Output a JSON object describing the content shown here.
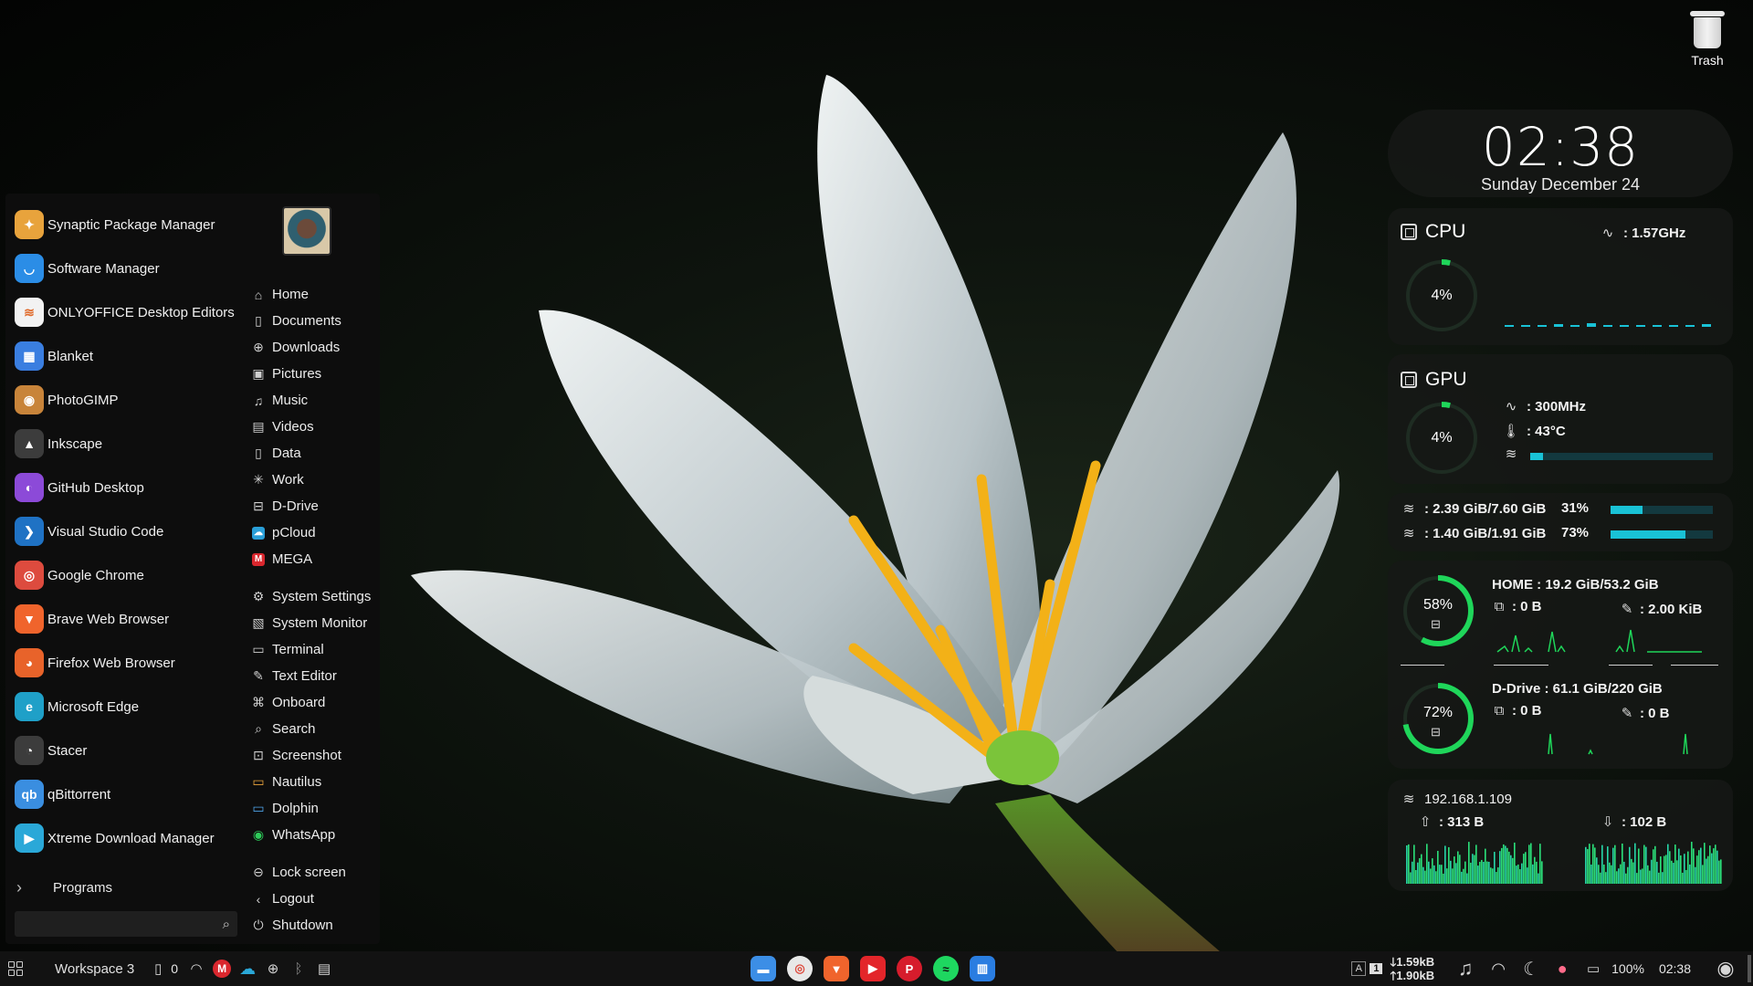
{
  "desktop": {
    "trash_label": "Trash"
  },
  "menu": {
    "apps": [
      {
        "label": "Synaptic Package Manager",
        "icon": "synaptic-icon",
        "color": "#e8a33c",
        "glyph": "✦"
      },
      {
        "label": "Software Manager",
        "icon": "software-manager-icon",
        "color": "#2b8de6",
        "glyph": "◡"
      },
      {
        "label": "ONLYOFFICE Desktop Editors",
        "icon": "onlyoffice-icon",
        "color": "#f2f2f2",
        "glyph": "≋"
      },
      {
        "label": "Blanket",
        "icon": "blanket-icon",
        "color": "#3a7ee0",
        "glyph": "▦"
      },
      {
        "label": "PhotoGIMP",
        "icon": "photogimp-icon",
        "color": "#c8843a",
        "glyph": "◉"
      },
      {
        "label": "Inkscape",
        "icon": "inkscape-icon",
        "color": "#3c3c3c",
        "glyph": "▲"
      },
      {
        "label": "GitHub Desktop",
        "icon": "github-desktop-icon",
        "color": "#8c4ad8",
        "glyph": "◐"
      },
      {
        "label": "Visual Studio Code",
        "icon": "vscode-icon",
        "color": "#1f72c4",
        "glyph": "❯"
      },
      {
        "label": "Google Chrome",
        "icon": "google-chrome-icon",
        "color": "#dd4b3e",
        "glyph": "◎"
      },
      {
        "label": "Brave Web Browser",
        "icon": "brave-icon",
        "color": "#f0642c",
        "glyph": "▼"
      },
      {
        "label": "Firefox Web Browser",
        "icon": "firefox-icon",
        "color": "#e8632a",
        "glyph": "◕"
      },
      {
        "label": "Microsoft Edge",
        "icon": "microsoft-edge-icon",
        "color": "#1fa0c8",
        "glyph": "e"
      },
      {
        "label": "Stacer",
        "icon": "stacer-icon",
        "color": "#3c3c3c",
        "glyph": "◔"
      },
      {
        "label": "qBittorrent",
        "icon": "qbittorrent-icon",
        "color": "#3a8ee0",
        "glyph": "qb"
      },
      {
        "label": "Xtreme Download Manager",
        "icon": "xdm-icon",
        "color": "#2aa8d8",
        "glyph": "▶"
      }
    ],
    "programs_label": "Programs",
    "search_placeholder": "",
    "places": [
      {
        "label": "Home",
        "icon": "home-icon",
        "glyph": "⌂"
      },
      {
        "label": "Documents",
        "icon": "documents-icon",
        "glyph": "▯"
      },
      {
        "label": "Downloads",
        "icon": "downloads-icon",
        "glyph": "⊕"
      },
      {
        "label": "Pictures",
        "icon": "pictures-icon",
        "glyph": "▣"
      },
      {
        "label": "Music",
        "icon": "music-icon",
        "glyph": "♫"
      },
      {
        "label": "Videos",
        "icon": "videos-icon",
        "glyph": "▤"
      },
      {
        "label": "Data",
        "icon": "data-icon",
        "glyph": "▯"
      },
      {
        "label": "Work",
        "icon": "work-icon",
        "glyph": "✳"
      },
      {
        "label": "D-Drive",
        "icon": "d-drive-icon",
        "glyph": "⊟"
      },
      {
        "label": "pCloud",
        "icon": "pcloud-icon",
        "glyph": "☁",
        "box": "#2a9fd8"
      },
      {
        "label": "MEGA",
        "icon": "mega-icon",
        "glyph": "M",
        "box": "#d9272e"
      }
    ],
    "system": [
      {
        "label": "System Settings",
        "icon": "gear-icon",
        "glyph": "⚙"
      },
      {
        "label": "System Monitor",
        "icon": "system-monitor-icon",
        "glyph": "▧"
      },
      {
        "label": "Terminal",
        "icon": "terminal-icon",
        "glyph": "▭"
      },
      {
        "label": "Text Editor",
        "icon": "text-editor-icon",
        "glyph": "✎"
      },
      {
        "label": "Onboard",
        "icon": "keyboard-icon",
        "glyph": "⌘"
      },
      {
        "label": "Search",
        "icon": "search-icon",
        "glyph": "⌕"
      },
      {
        "label": "Screenshot",
        "icon": "screenshot-icon",
        "glyph": "⊡"
      },
      {
        "label": "Nautilus",
        "icon": "nautilus-icon",
        "glyph": "▭",
        "color": "#e8a33c"
      },
      {
        "label": "Dolphin",
        "icon": "dolphin-icon",
        "glyph": "▭",
        "color": "#4ea4e8"
      },
      {
        "label": "WhatsApp",
        "icon": "whatsapp-icon",
        "glyph": "◉",
        "color": "#2ecc5a"
      }
    ],
    "session": [
      {
        "label": "Lock screen",
        "icon": "lock-icon",
        "glyph": "⊖"
      },
      {
        "label": "Logout",
        "icon": "logout-icon",
        "glyph": "‹"
      },
      {
        "label": "Shutdown",
        "icon": "power-icon",
        "glyph": "⏻"
      }
    ]
  },
  "clock": {
    "time": "02:38",
    "date": "Sunday December 24"
  },
  "cpu": {
    "title": "CPU",
    "usage": "4%",
    "usage_value": 0.04,
    "freq": ": 1.57GHz",
    "graph": [
      2,
      2,
      2,
      3,
      2,
      4,
      2,
      2,
      2,
      2,
      2,
      2,
      3
    ]
  },
  "gpu": {
    "title": "GPU",
    "usage": "4%",
    "usage_value": 0.04,
    "freq": ": 300MHz",
    "temp": ": 43°C",
    "vram_fraction": 0.07
  },
  "memory": [
    {
      "label": ": 2.39 GiB/7.60 GiB",
      "pct": "31%",
      "fraction": 0.31
    },
    {
      "label": ": 1.40 GiB/1.91 GiB",
      "pct": "73%",
      "fraction": 0.73
    }
  ],
  "disks": [
    {
      "name": "HOME : 19.2 GiB/53.2 GiB",
      "pct": "58%",
      "fraction": 0.58,
      "read": ": 0 B",
      "write": ": 2.00 KiB"
    },
    {
      "name": "D-Drive : 61.1 GiB/220 GiB",
      "pct": "72%",
      "fraction": 0.72,
      "read": ": 0 B",
      "write": ": 0 B"
    }
  ],
  "network": {
    "ip": "192.168.1.109",
    "up": ": 313 B",
    "down": ": 102 B"
  },
  "taskbar": {
    "workspace": "Workspace 3",
    "phone_count": "0",
    "net_down_rate": "1.59kB",
    "net_up_rate": "1.90kB",
    "battery": "100%",
    "time": "02:38",
    "keyboard_layout": "1"
  },
  "colors": {
    "accent": "#19c2d6",
    "ring": "#1fd65a",
    "graph": "#2be07a"
  }
}
